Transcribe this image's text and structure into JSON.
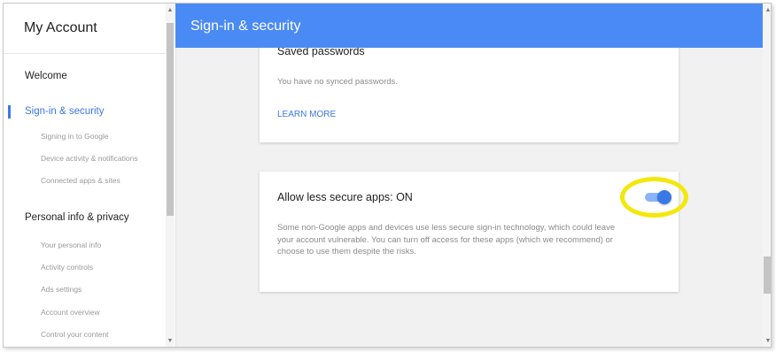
{
  "sidebar": {
    "title": "My Account",
    "sections": [
      {
        "label": "Welcome"
      },
      {
        "label": "Sign-in & security",
        "active": true,
        "items": [
          "Signing in to Google",
          "Device activity & notifications",
          "Connected apps & sites"
        ]
      },
      {
        "label": "Personal info & privacy",
        "items": [
          "Your personal info",
          "Activity controls",
          "Ads settings",
          "Account overview",
          "Control your content"
        ]
      }
    ]
  },
  "header": {
    "title": "Sign-in & security"
  },
  "saved_passwords": {
    "heading": "Saved passwords",
    "text": "You have no synced passwords.",
    "link": "LEARN MORE"
  },
  "less_secure": {
    "heading": "Allow less secure apps: ON",
    "text": "Some non-Google apps and devices use less secure sign-in technology, which could leave your account vulnerable. You can turn off access for these apps (which we recommend) or choose to use them despite the risks.",
    "toggle_on": true
  },
  "colors": {
    "accent": "#4a8af4",
    "link": "#3b78e7",
    "highlight": "#f3e80b"
  },
  "icons": {
    "scroll_up": "▲",
    "scroll_down": "▼"
  }
}
